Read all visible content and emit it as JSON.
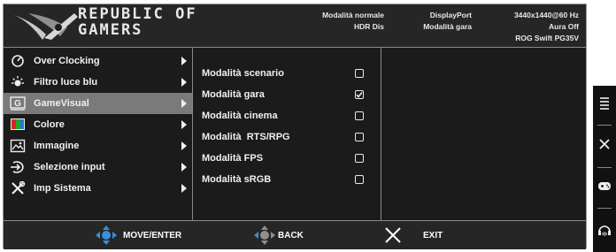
{
  "header": {
    "brand_line1": "REPUBLIC OF",
    "brand_line2": "GAMERS",
    "info_col1": [
      "Modalità normale",
      "HDR Dis"
    ],
    "info_col2": [
      "DisplayPort",
      "Modalità gara"
    ],
    "info_col3": [
      "3440x1440@60 Hz",
      "Aura Off",
      "ROG Swift PG35V"
    ]
  },
  "main_menu": [
    {
      "label": "Over Clocking",
      "icon": "gauge-icon"
    },
    {
      "label": "Filtro luce blu",
      "icon": "sun-icon"
    },
    {
      "label": "GameVisual",
      "icon": "gamevisual-icon"
    },
    {
      "label": "Colore",
      "icon": "color-icon"
    },
    {
      "label": "Immagine",
      "icon": "image-icon"
    },
    {
      "label": "Selezione input",
      "icon": "input-icon"
    },
    {
      "label": "Imp Sistema",
      "icon": "tools-icon"
    }
  ],
  "selected_main": "GameVisual",
  "sub_menu": [
    {
      "label": "Modalità scenario",
      "checked": false
    },
    {
      "label": "Modalità gara",
      "checked": true
    },
    {
      "label": "Modalità cinema",
      "checked": false
    },
    {
      "label": "Modalità  RTS/RPG",
      "checked": false
    },
    {
      "label": "Modalità FPS",
      "checked": false
    },
    {
      "label": "Modalità sRGB",
      "checked": false
    }
  ],
  "footer": {
    "move_label": "MOVE/ENTER",
    "back_label": "BACK",
    "exit_label": "EXIT"
  },
  "side_buttons": [
    "menu-icon",
    "close-icon",
    "gamepad-icon",
    "headphone-icon"
  ],
  "colors": {
    "osd_bg": "#1b1b1b",
    "selected_bg": "#7a7a7a",
    "nav_blue": "#3b8fd9"
  }
}
